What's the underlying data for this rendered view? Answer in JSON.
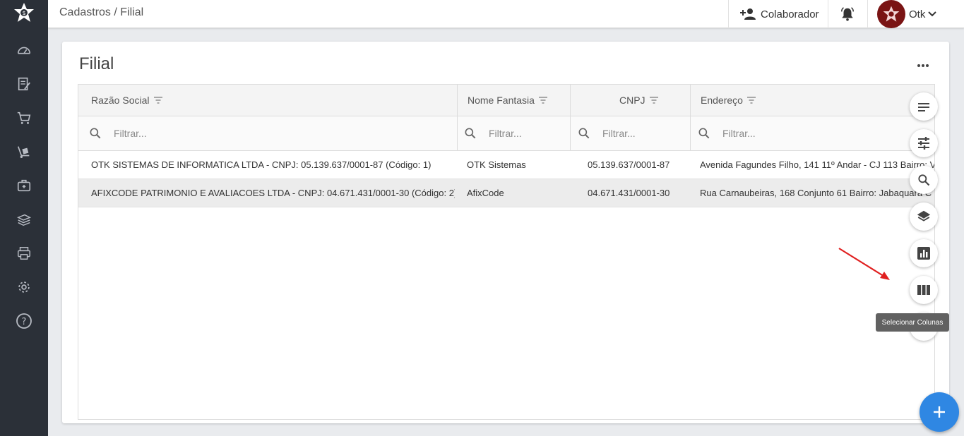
{
  "breadcrumb": "Cadastros / Filial",
  "topbar": {
    "collaborator_label": "Colaborador",
    "user_name": "Otk"
  },
  "sidebar": {
    "items": [
      {
        "icon": "dashboard-icon"
      },
      {
        "icon": "edit-document-icon"
      },
      {
        "icon": "cart-icon"
      },
      {
        "icon": "hand-truck-icon"
      },
      {
        "icon": "briefcase-icon"
      },
      {
        "icon": "money-stack-icon"
      },
      {
        "icon": "printer-icon"
      },
      {
        "icon": "gear-icon"
      },
      {
        "icon": "help-icon"
      }
    ]
  },
  "page": {
    "title": "Filial"
  },
  "grid": {
    "columns": [
      "Razão Social",
      "Nome Fantasia",
      "CNPJ",
      "Endereço"
    ],
    "filter_placeholder": "Filtrar...",
    "rows": [
      {
        "razao_social": "OTK SISTEMAS DE INFORMATICA LTDA - CNPJ: 05.139.637/0001-87 (Código: 1)",
        "nome_fantasia": "OTK Sistemas",
        "cnpj": "05.139.637/0001-87",
        "endereco": "Avenida Fagundes Filho, 141 11º Andar - CJ 113 Bairro: V",
        "selected": false
      },
      {
        "razao_social": "AFIXCODE PATRIMONIO E AVALIACOES LTDA - CNPJ: 04.671.431/0001-30 (Código: 2)",
        "nome_fantasia": "AfixCode",
        "cnpj": "04.671.431/0001-30",
        "endereco": "Rua Carnaubeiras, 168 Conjunto 61 Bairro: Jabaquara C",
        "selected": true
      }
    ]
  },
  "toolbar": {
    "buttons": [
      "sort-lines-icon",
      "tune-icon",
      "search-icon",
      "layers-icon",
      "chart-icon",
      "columns-icon"
    ],
    "tooltip": "Selecionar Colunas"
  },
  "colors": {
    "sidebar": "#2b3038",
    "accent": "#2f87e3",
    "avatar": "#7a1414",
    "arrow": "#e02020"
  }
}
